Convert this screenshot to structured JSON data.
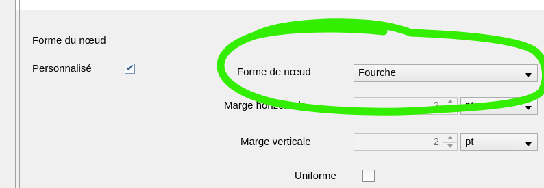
{
  "group": {
    "title": "Forme du nœud"
  },
  "custom": {
    "label": "Personnalisé",
    "checked": true
  },
  "shape": {
    "label": "Forme de nœud",
    "value": "Fourche"
  },
  "hmargin": {
    "label": "Marge horizontale",
    "value": "2",
    "unit": "pt"
  },
  "vmargin": {
    "label": "Marge verticale",
    "value": "2",
    "unit": "pt"
  },
  "uniform": {
    "label": "Uniforme",
    "checked": false
  },
  "annotation_color": "#33ee00"
}
